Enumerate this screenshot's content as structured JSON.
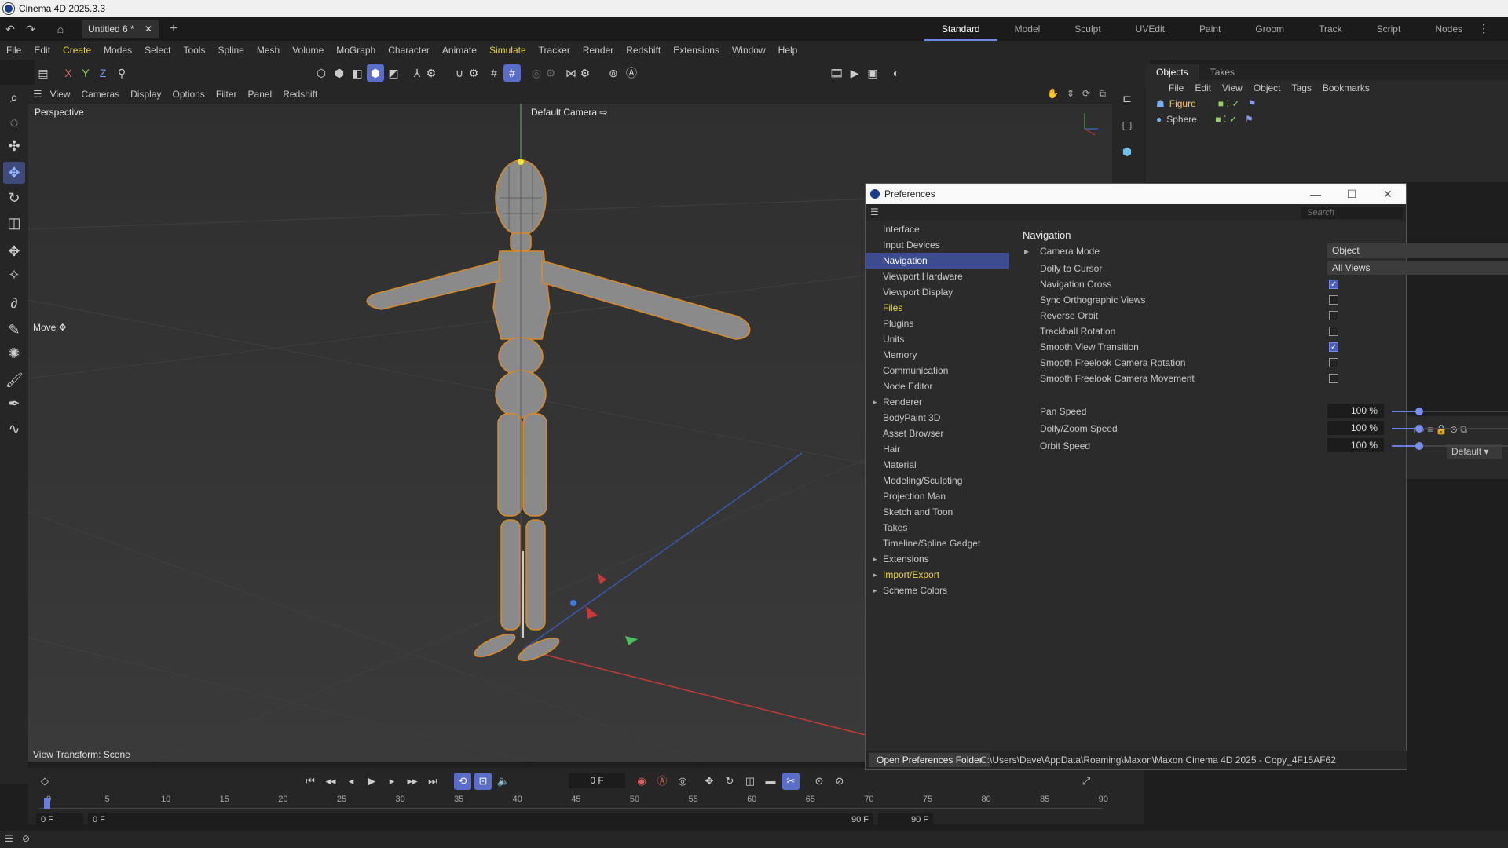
{
  "app": {
    "title": "Cinema 4D 2025.3.3"
  },
  "tabs": {
    "doc_tab": "Untitled 6 *",
    "close": "✕",
    "add": "+"
  },
  "layouts": [
    "Standard",
    "Model",
    "Sculpt",
    "UVEdit",
    "Paint",
    "Groom",
    "Track",
    "Script",
    "Nodes"
  ],
  "menu": [
    "File",
    "Edit",
    "Create",
    "Modes",
    "Select",
    "Tools",
    "Spline",
    "Mesh",
    "Volume",
    "MoGraph",
    "Character",
    "Animate",
    "Simulate",
    "Tracker",
    "Render",
    "Redshift",
    "Extensions",
    "Window",
    "Help"
  ],
  "toolbar": {
    "x": "X",
    "y": "Y",
    "z": "Z"
  },
  "viewport": {
    "menu": [
      "View",
      "Cameras",
      "Display",
      "Options",
      "Filter",
      "Panel",
      "Redshift"
    ],
    "projection": "Perspective",
    "camera": "Default Camera",
    "tool_label": "Move",
    "view_transform": "View Transform: Scene"
  },
  "objects": {
    "tabs": [
      "Objects",
      "Takes"
    ],
    "menu": [
      "File",
      "Edit",
      "View",
      "Object",
      "Tags",
      "Bookmarks"
    ],
    "items": [
      "Figure",
      "Sphere"
    ]
  },
  "attributes": {
    "preset": "Default"
  },
  "timeline": {
    "current_frame": "0 F",
    "ticks": [
      "0",
      "5",
      "10",
      "15",
      "20",
      "25",
      "30",
      "35",
      "40",
      "45",
      "50",
      "55",
      "60",
      "65",
      "70",
      "75",
      "80",
      "85",
      "90"
    ],
    "start": "0 F",
    "preview_start": "0 F",
    "preview_end": "90 F",
    "end": "90 F"
  },
  "preferences": {
    "title": "Preferences",
    "search_placeholder": "Search",
    "sidebar": [
      {
        "label": "Interface",
        "state": ""
      },
      {
        "label": "Input Devices",
        "state": ""
      },
      {
        "label": "Navigation",
        "state": "selected"
      },
      {
        "label": "Viewport Hardware",
        "state": ""
      },
      {
        "label": "Viewport Display",
        "state": ""
      },
      {
        "label": "Files",
        "state": "yellow"
      },
      {
        "label": "Plugins",
        "state": ""
      },
      {
        "label": "Units",
        "state": ""
      },
      {
        "label": "Memory",
        "state": ""
      },
      {
        "label": "Communication",
        "state": ""
      },
      {
        "label": "Node Editor",
        "state": ""
      },
      {
        "label": "Renderer",
        "state": "expand"
      },
      {
        "label": "BodyPaint 3D",
        "state": ""
      },
      {
        "label": "Asset Browser",
        "state": ""
      },
      {
        "label": "Hair",
        "state": ""
      },
      {
        "label": "Material",
        "state": ""
      },
      {
        "label": "Modeling/Sculpting",
        "state": ""
      },
      {
        "label": "Projection Man",
        "state": ""
      },
      {
        "label": "Sketch and Toon",
        "state": ""
      },
      {
        "label": "Takes",
        "state": ""
      },
      {
        "label": "Timeline/Spline Gadget",
        "state": ""
      },
      {
        "label": "Extensions",
        "state": "expand"
      },
      {
        "label": "Import/Export",
        "state": "expand-yellow"
      },
      {
        "label": "Scheme Colors",
        "state": "expand"
      }
    ],
    "section_title": "Navigation",
    "camera_mode": {
      "label": "Camera Mode",
      "value": "Object"
    },
    "dolly_to_cursor": {
      "label": "Dolly to Cursor",
      "value": "All Views"
    },
    "checkboxes": [
      {
        "label": "Navigation Cross",
        "checked": true
      },
      {
        "label": "Sync Orthographic Views",
        "checked": false
      },
      {
        "label": "Reverse Orbit",
        "checked": false
      },
      {
        "label": "Trackball Rotation",
        "checked": false
      },
      {
        "label": "Smooth View Transition",
        "checked": true
      },
      {
        "label": "Smooth Freelook Camera Rotation",
        "checked": false
      },
      {
        "label": "Smooth Freelook Camera Movement",
        "checked": false
      }
    ],
    "speeds": [
      {
        "label": "Pan Speed",
        "value": "100 %",
        "fraction": 0.17
      },
      {
        "label": "Dolly/Zoom Speed",
        "value": "100 %",
        "fraction": 0.17
      },
      {
        "label": "Orbit Speed",
        "value": "100 %",
        "fraction": 0.17
      }
    ],
    "open_folder_button": "Open Preferences Folder",
    "folder_path": "C:\\Users\\Dave\\AppData\\Roaming\\Maxon\\Maxon Cinema 4D 2025 - Copy_4F15AF62"
  },
  "colors": {
    "accent": "#5a6dc8",
    "highlight": "#e5d24a",
    "selected": "#3d4c8e"
  }
}
